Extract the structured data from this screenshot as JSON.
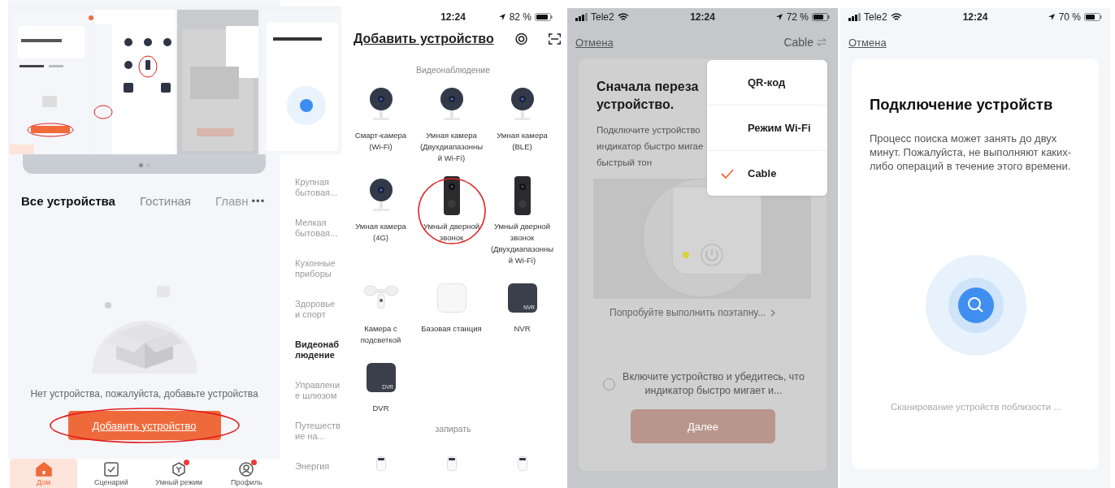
{
  "home_screen": {
    "carousel_dots": [
      {
        "selected": true
      },
      {
        "selected": false
      }
    ],
    "room_tabs": [
      {
        "label": "Все устройства",
        "selected": true
      },
      {
        "label": "Гостиная",
        "selected": false
      },
      {
        "label": "Главн",
        "selected": false
      }
    ],
    "more_button": "•••",
    "empty_message": "Нет устройства, пожалуйста, добавьте устройства",
    "add_button": {
      "label": "Добавить устройство",
      "circled": true
    },
    "tab_bar": [
      {
        "label": "Дом",
        "selected": true,
        "badge": false
      },
      {
        "label": "Сценарий",
        "selected": false,
        "badge": false
      },
      {
        "label": "Умный режим",
        "selected": false,
        "badge": true
      },
      {
        "label": "Профиль",
        "selected": false,
        "badge": true
      }
    ]
  },
  "add_device_screen": {
    "status_bar": {
      "time": "12:24",
      "battery": "82 %"
    },
    "title": "Добавить устройство",
    "categories": [
      {
        "label": "Крупная бытовая...",
        "selected": false
      },
      {
        "label": "Мелкая бытовая...",
        "selected": false
      },
      {
        "label": "Кухонные приборы",
        "selected": false
      },
      {
        "label": "Здоровье и спорт",
        "selected": false
      },
      {
        "label": "Видеонаблюдение",
        "selected": true
      },
      {
        "label": "Управление шлюзом",
        "selected": false
      },
      {
        "label": "Путешествие на...",
        "selected": false
      },
      {
        "label": "Энергия",
        "selected": false
      }
    ],
    "sections": [
      {
        "title": "Видеонаблюдение",
        "devices": [
          {
            "kind": "camera",
            "name": "Смарт-камера (Wi-Fi)",
            "circled": false
          },
          {
            "kind": "camera",
            "name": "Умная камера (Двухдиапазонный Wi-Fi)",
            "circled": false
          },
          {
            "kind": "camera",
            "name": "Умная камера (BLE)",
            "circled": false
          },
          {
            "kind": "camera",
            "name": "Умная камера (4G)",
            "circled": false
          },
          {
            "kind": "doorbell",
            "name": "Умный дверной звонок",
            "circled": true
          },
          {
            "kind": "doorbell",
            "name": "Умный дверной звонок (Двухдиапазонный Wi-Fi)",
            "circled": false
          },
          {
            "kind": "floodlight",
            "name": "Камера с подсветкой",
            "circled": false
          },
          {
            "kind": "hub",
            "name": "Базовая станция",
            "circled": false
          },
          {
            "kind": "recorder",
            "name": "NVR",
            "badge": "NVR",
            "circled": false
          },
          {
            "kind": "recorder",
            "name": "DVR",
            "badge": "DVR",
            "circled": false
          }
        ]
      },
      {
        "title": "запирать",
        "devices": [
          {
            "kind": "lock",
            "circled": false
          },
          {
            "kind": "lock",
            "circled": false
          },
          {
            "kind": "lock",
            "circled": false
          }
        ]
      }
    ]
  },
  "pairing_screen": {
    "status_bar": {
      "carrier": "Tele2",
      "time": "12:24",
      "battery": "72 %"
    },
    "cancel": "Отмена",
    "mode_button": "Cable",
    "title_lines": [
      "Сначала переза",
      "устройство."
    ],
    "description_lines": [
      "Подключите устройство",
      "индикатор быстро мигае",
      "быстрый тон"
    ],
    "guide_link": "Попробуйте выполнить поэтапну...",
    "confirm": {
      "label": "Включите устройство и убедитесь, что индикатор быстро мигает и...",
      "checked": false
    },
    "next_button": {
      "label": "Далее",
      "disabled": true
    },
    "mode_menu": [
      {
        "label": "QR-код",
        "selected": false
      },
      {
        "label": "Режим Wi-Fi",
        "selected": false
      },
      {
        "label": "Cable",
        "selected": true
      }
    ]
  },
  "scanning_screen": {
    "status_bar": {
      "carrier": "Tele2",
      "time": "12:24",
      "battery": "70 %"
    },
    "cancel": "Отмена",
    "title": "Подключение устройств",
    "description": "Процесс поиска может занять до двух минут. Пожалуйста, не выполняют каких-либо операций в течение этого времени.",
    "status": "Сканирование устройств поблизости ..."
  }
}
